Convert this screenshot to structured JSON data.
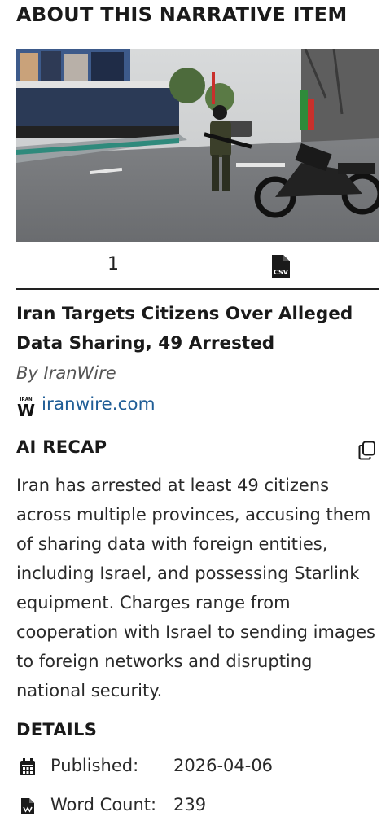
{
  "header": {
    "title": "ABOUT THIS NARRATIVE ITEM"
  },
  "media": {
    "image_alt": "Armed man standing on a street next to a motorcycle with flags"
  },
  "toolbar": {
    "count": "1",
    "csv_icon": "csv-file-icon",
    "csv_label": "CSV"
  },
  "article": {
    "title": "Iran Targets Citizens Over Alleged Data Sharing, 49 Arrested",
    "byline": "By IranWire",
    "source_logo_text": "IRAN",
    "source_logo_letter": "W",
    "source": "iranwire.com"
  },
  "recap": {
    "title": "AI RECAP",
    "copy_icon": "copy-icon",
    "text": "Iran has arrested at least 49 citizens across multiple provinces, accusing them of sharing data with foreign entities, including Israel, and possessing Starlink equipment. Charges range from cooperation with Israel to sending images to foreign networks and disrupting national security."
  },
  "details": {
    "title": "DETAILS",
    "published_label": "Published:",
    "published_value": "2026-04-06",
    "published_icon": "calendar-icon",
    "word_count_label": "Word Count:",
    "word_count_value": "239",
    "word_count_icon": "document-icon"
  },
  "colors": {
    "link": "#1f5d96",
    "text": "#1f1f1f",
    "divider": "#222222"
  }
}
